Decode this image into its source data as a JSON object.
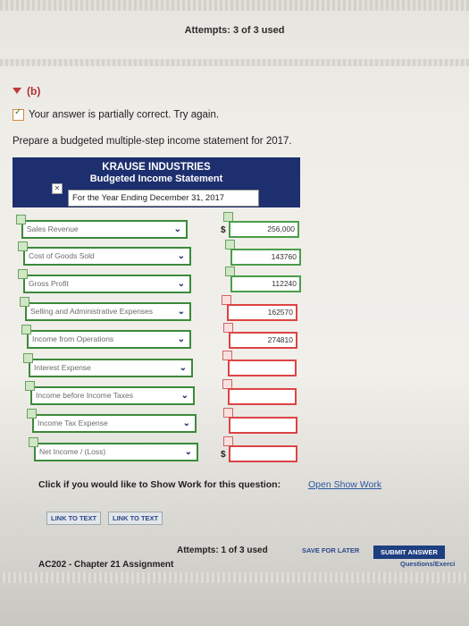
{
  "top": {
    "attempts": "Attempts: 3 of 3 used"
  },
  "section": {
    "label": "(b)"
  },
  "status": {
    "message": "Your answer is partially correct.  Try again."
  },
  "prompt": "Prepare a budgeted multiple-step income statement for 2017.",
  "statement": {
    "company": "KRAUSE INDUSTRIES",
    "title": "Budgeted Income Statement",
    "period": "For the Year Ending December 31, 2017",
    "rows": [
      {
        "label": "Sales Revenue",
        "value": "256,000",
        "dollar": "$",
        "status": "ok"
      },
      {
        "label": "Cost of Goods Sold",
        "value": "143760",
        "dollar": "",
        "status": "ok"
      },
      {
        "label": "Gross Profit",
        "value": "112240",
        "dollar": "",
        "status": "ok"
      },
      {
        "label": "Selling and Administrative Expenses",
        "value": "162570",
        "dollar": "",
        "status": "bad"
      },
      {
        "label": "Income from Operations",
        "value": "274810",
        "dollar": "",
        "status": "bad"
      },
      {
        "label": "Interest Expense",
        "value": "",
        "dollar": "",
        "status": "bad"
      },
      {
        "label": "Income before Income Taxes",
        "value": "",
        "dollar": "",
        "status": "bad"
      },
      {
        "label": "Income Tax Expense",
        "value": "",
        "dollar": "",
        "status": "bad"
      },
      {
        "label": "Net Income / (Loss)",
        "value": "",
        "dollar": "$",
        "status": "bad"
      }
    ]
  },
  "show_work": {
    "text": "Click if you would like to Show Work for this question:",
    "link": "Open Show Work"
  },
  "buttons": {
    "link1": "LINK TO TEXT",
    "link2": "LINK TO TEXT",
    "save": "SAVE FOR LATER",
    "submit": "SUBMIT ANSWER"
  },
  "bottom": {
    "attempts": "Attempts: 1 of 3 used",
    "assignment": "AC202 - Chapter 21 Assignment",
    "nav": "Questions/Exerci"
  }
}
